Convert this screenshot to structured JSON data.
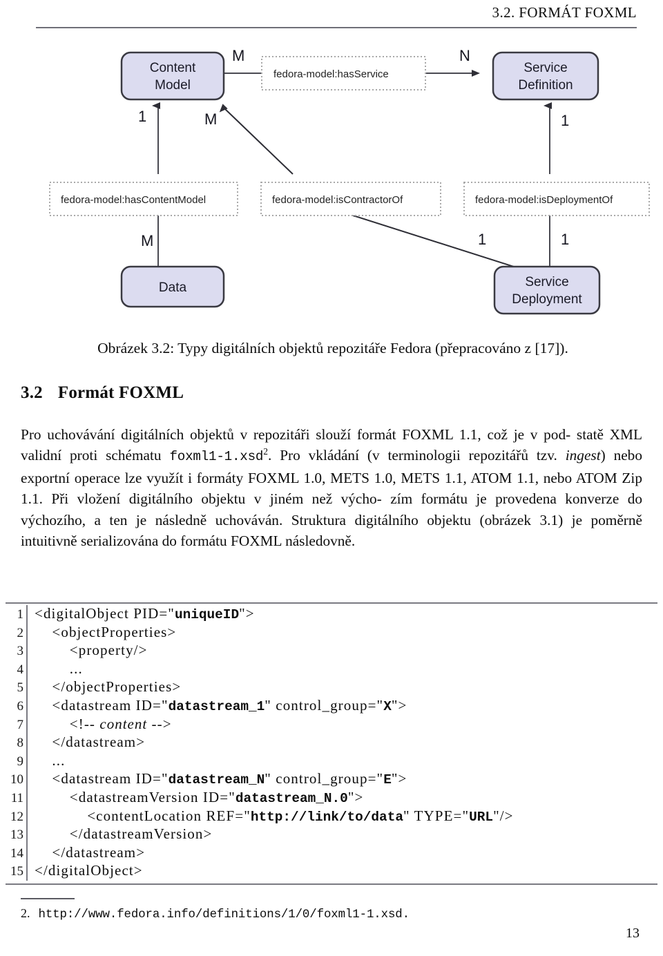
{
  "header": {
    "title": "3.2.  FORMÁT FOXML"
  },
  "figure": {
    "nodes": [
      {
        "id": "content-model",
        "line1": "Content",
        "line2": "Model"
      },
      {
        "id": "service-definition",
        "line1": "Service",
        "line2": "Definition"
      },
      {
        "id": "data",
        "line1": "Data",
        "line2": ""
      },
      {
        "id": "service-deployment",
        "line1": "Service",
        "line2": "Deployment"
      }
    ],
    "relations": [
      {
        "id": "has-service",
        "label": "fedora-model:hasService"
      },
      {
        "id": "has-content-model",
        "label": "fedora-model:hasContentModel"
      },
      {
        "id": "is-contractor-of",
        "label": "fedora-model:isContractorOf"
      },
      {
        "id": "is-deployment-of",
        "label": "fedora-model:isDeploymentOf"
      }
    ],
    "cardinalities": [
      {
        "id": "card-cm-hasservice",
        "value": "M"
      },
      {
        "id": "card-sd-hasservice",
        "value": "N"
      },
      {
        "id": "card-cm-hascontentmodel",
        "value": "1"
      },
      {
        "id": "card-cm-iscontractor",
        "value": "M"
      },
      {
        "id": "card-sd-isdeployment",
        "value": "1"
      },
      {
        "id": "card-data-hascontentmodel",
        "value": "M"
      },
      {
        "id": "card-sdep-iscontractor",
        "value": "1"
      },
      {
        "id": "card-sdep-isdeployment",
        "value": "1"
      }
    ],
    "colors": {
      "node_fill": "#dcdcf0",
      "node_stroke": "#3a3a42",
      "relation_stroke": "#a8a8a8",
      "edge_stroke": "#4a4a52"
    },
    "caption": "Obrázek 3.2: Typy digitálních objektů repozitáře Fedora (přepracováno z [17])."
  },
  "section": {
    "number": "3.2",
    "title": "Formát FOXML"
  },
  "paragraph": {
    "p1": "Pro uchovávání digitálních objektů v repozitáři slouží formát FOXML 1.1, což je v pod-",
    "p2_a": "statě XML validní proti schématu ",
    "p2_mono": "foxml1-1.xsd",
    "p2_sup": "2",
    "p2_b": ". Pro vkládání (v terminologii repozitářů",
    "p3_a": "tzv. ",
    "p3_ital": "ingest",
    "p3_b": ") nebo exportní operace lze využít i formáty FOXML 1.0, METS 1.0, METS",
    "p4": "1.1, ATOM 1.1, nebo ATOM Zip 1.1. Při vložení digitálního objektu v jiném než výcho-",
    "p5": "zím formátu je provedena konverze do výchozího, a ten je následně uchováván. Struktura",
    "p6": "digitálního objektu (obrázek 3.1) je poměrně intuitivně serializována do formátu FOXML",
    "p7": "následovně."
  },
  "listing": {
    "lines": [
      {
        "num": "1",
        "parts": [
          {
            "t": "tag",
            "s": "<digitalObject PID=\""
          },
          {
            "t": "val",
            "s": "uniqueID"
          },
          {
            "t": "tag",
            "s": "\">"
          }
        ]
      },
      {
        "num": "2",
        "parts": [
          {
            "t": "tag",
            "s": "    <objectProperties>"
          }
        ]
      },
      {
        "num": "3",
        "parts": [
          {
            "t": "tag",
            "s": "        <property/>"
          }
        ]
      },
      {
        "num": "4",
        "parts": [
          {
            "t": "tag",
            "s": "        ..."
          }
        ]
      },
      {
        "num": "5",
        "parts": [
          {
            "t": "tag",
            "s": "    </objectProperties>"
          }
        ]
      },
      {
        "num": "6",
        "parts": [
          {
            "t": "tag",
            "s": "    <datastream ID=\""
          },
          {
            "t": "val",
            "s": "datastream_1"
          },
          {
            "t": "tag",
            "s": "\" control_group=\""
          },
          {
            "t": "val",
            "s": "X"
          },
          {
            "t": "tag",
            "s": "\">"
          }
        ]
      },
      {
        "num": "7",
        "parts": [
          {
            "t": "tag",
            "s": "        <!-- "
          },
          {
            "t": "cmt",
            "s": "content"
          },
          {
            "t": "tag",
            "s": " -->"
          }
        ]
      },
      {
        "num": "8",
        "parts": [
          {
            "t": "tag",
            "s": "    </datastream>"
          }
        ]
      },
      {
        "num": "9",
        "parts": [
          {
            "t": "tag",
            "s": "    ..."
          }
        ]
      },
      {
        "num": "10",
        "parts": [
          {
            "t": "tag",
            "s": "    <datastream ID=\""
          },
          {
            "t": "val",
            "s": "datastream_N"
          },
          {
            "t": "tag",
            "s": "\" control_group=\""
          },
          {
            "t": "val",
            "s": "E"
          },
          {
            "t": "tag",
            "s": "\">"
          }
        ]
      },
      {
        "num": "11",
        "parts": [
          {
            "t": "tag",
            "s": "        <datastreamVersion ID=\""
          },
          {
            "t": "val",
            "s": "datastream_N.0"
          },
          {
            "t": "tag",
            "s": "\">"
          }
        ]
      },
      {
        "num": "12",
        "parts": [
          {
            "t": "tag",
            "s": "            <contentLocation REF=\""
          },
          {
            "t": "val",
            "s": "http://link/to/data"
          },
          {
            "t": "tag",
            "s": "\" TYPE=\""
          },
          {
            "t": "val",
            "s": "URL"
          },
          {
            "t": "tag",
            "s": "\"/>"
          }
        ]
      },
      {
        "num": "13",
        "parts": [
          {
            "t": "tag",
            "s": "        </datastreamVersion>"
          }
        ]
      },
      {
        "num": "14",
        "parts": [
          {
            "t": "tag",
            "s": "    </datastream>"
          }
        ]
      },
      {
        "num": "15",
        "parts": [
          {
            "t": "tag",
            "s": "</digitalObject>"
          }
        ]
      }
    ]
  },
  "footnote": {
    "number": "2.",
    "url": "http://www.fedora.info/definitions/1/0/foxml1-1.xsd."
  },
  "page_number": "13"
}
